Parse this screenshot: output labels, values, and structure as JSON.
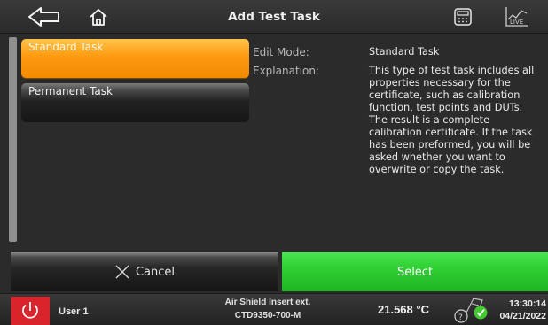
{
  "header": {
    "title": "Add Test Task",
    "back_icon": "back-arrow-icon",
    "home_icon": "home-icon",
    "calculator_icon": "calculator-icon",
    "live_icon": "live-chart-icon",
    "live_label": "LIVE"
  },
  "task_list": {
    "items": [
      {
        "label": "Standard Task",
        "selected": true
      },
      {
        "label": "Permanent Task",
        "selected": false
      }
    ]
  },
  "details": {
    "edit_mode_label": "Edit Mode:",
    "edit_mode_value": "Standard Task",
    "explanation_label": "Explanation:",
    "explanation_lines": [
      "This type of test task includes all",
      "properties necessary for the",
      "certificate, such as calibration",
      "function, test points and DUTs.",
      "The result is a complete",
      "calibration certificate. If the task",
      "has been preformed, you will be",
      "asked whether you want to",
      "overwrite or copy the task."
    ]
  },
  "buttons": {
    "cancel_label": "Cancel",
    "select_label": "Select"
  },
  "status_bar": {
    "user": "User 1",
    "instrument_name": "Air Shield Insert ext.",
    "instrument_model": "CTD9350-700-M",
    "temperature": "21.568 °C",
    "time": "13:30:14",
    "date": "04/21/2022"
  },
  "colors": {
    "selected_item": "#ff9a10",
    "select_button": "#2fd033",
    "power_button": "#d8242a",
    "background": "#2b2b2b"
  }
}
